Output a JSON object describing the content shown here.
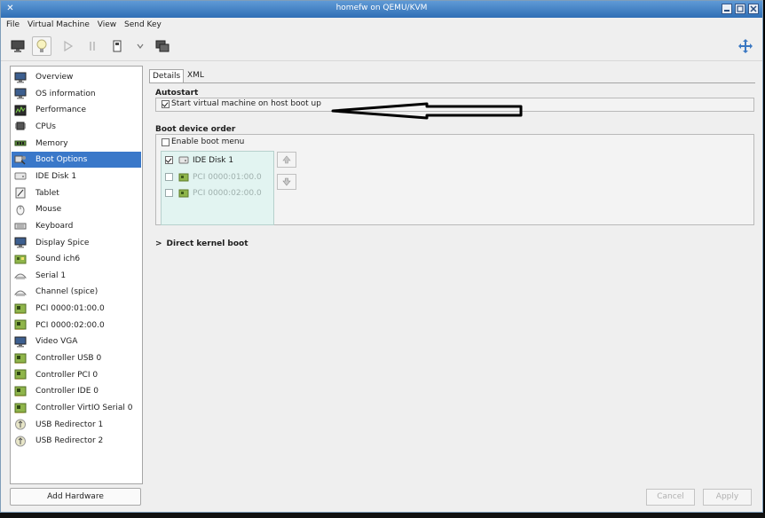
{
  "window": {
    "title": "homefw on QEMU/KVM"
  },
  "menu": {
    "items": [
      "File",
      "Virtual Machine",
      "View",
      "Send Key"
    ]
  },
  "sidebar": {
    "items": [
      {
        "label": "Overview",
        "icon": "monitor-icon"
      },
      {
        "label": "OS information",
        "icon": "monitor-icon"
      },
      {
        "label": "Performance",
        "icon": "performance-icon"
      },
      {
        "label": "CPUs",
        "icon": "cpu-icon"
      },
      {
        "label": "Memory",
        "icon": "memory-icon"
      },
      {
        "label": "Boot Options",
        "icon": "boot-options-icon"
      },
      {
        "label": "IDE Disk 1",
        "icon": "disk-icon"
      },
      {
        "label": "Tablet",
        "icon": "tablet-icon"
      },
      {
        "label": "Mouse",
        "icon": "mouse-icon"
      },
      {
        "label": "Keyboard",
        "icon": "keyboard-icon"
      },
      {
        "label": "Display Spice",
        "icon": "monitor-icon"
      },
      {
        "label": "Sound ich6",
        "icon": "sound-icon"
      },
      {
        "label": "Serial 1",
        "icon": "serial-icon"
      },
      {
        "label": "Channel (spice)",
        "icon": "serial-icon"
      },
      {
        "label": "PCI 0000:01:00.0",
        "icon": "pci-card-icon"
      },
      {
        "label": "PCI 0000:02:00.0",
        "icon": "pci-card-icon"
      },
      {
        "label": "Video VGA",
        "icon": "monitor-icon"
      },
      {
        "label": "Controller USB 0",
        "icon": "pci-card-icon"
      },
      {
        "label": "Controller PCI 0",
        "icon": "pci-card-icon"
      },
      {
        "label": "Controller IDE 0",
        "icon": "pci-card-icon"
      },
      {
        "label": "Controller VirtIO Serial 0",
        "icon": "pci-card-icon"
      },
      {
        "label": "USB Redirector 1",
        "icon": "usb-redirector-icon"
      },
      {
        "label": "USB Redirector 2",
        "icon": "usb-redirector-icon"
      }
    ],
    "selected": "Boot Options",
    "add_hardware": "Add Hardware"
  },
  "tabs": [
    "Details",
    "XML"
  ],
  "autostart": {
    "title": "Autostart",
    "checkbox_label": "Start virtual machine on host boot up",
    "checked": true
  },
  "boot_order": {
    "title": "Boot device order",
    "enable_menu_label": "Enable boot menu",
    "enable_menu_checked": false,
    "devices": [
      {
        "label": "IDE Disk 1",
        "checked": true,
        "enabled": true
      },
      {
        "label": "PCI 0000:01:00.0",
        "checked": false,
        "enabled": false
      },
      {
        "label": "PCI 0000:02:00.0",
        "checked": false,
        "enabled": false
      }
    ]
  },
  "direct_kernel_boot": {
    "label": "Direct kernel boot",
    "expander": ">"
  },
  "footer": {
    "cancel": "Cancel",
    "apply": "Apply"
  },
  "colors": {
    "selection": "#3a78c9",
    "titlebar": "#2f6eb5",
    "bootlist_bg": "#e2f4f1"
  }
}
